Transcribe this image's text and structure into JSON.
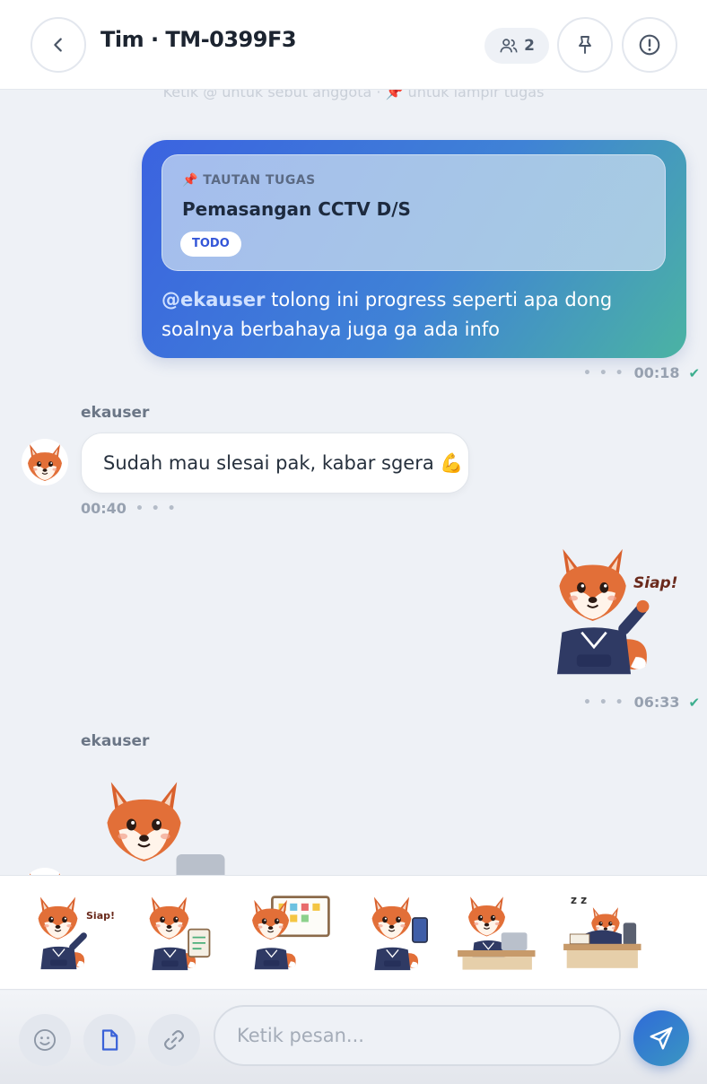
{
  "header": {
    "back_icon": "chevron-left-icon",
    "title": "Tim · TM-0399F3",
    "member_count": "2",
    "pin_icon": "pin-icon",
    "info_icon": "alert-circle-icon"
  },
  "hint": "Ketik @ untuk sebut anggota · 📌 untuk lampir tugas",
  "messages": [
    {
      "task_kicker": "📌 TAUTAN TUGAS",
      "task_title": "Pemasangan CCTV D/S",
      "task_status": "TODO",
      "mention": "@ekauser",
      "text": " tolong ini progress seperti apa dong soalnya berbahaya juga ga ada info",
      "time": "00:18"
    },
    {
      "sender": "ekauser",
      "text": "Sudah mau slesai pak, kabar sgera 💪",
      "time": "00:40"
    },
    {
      "sticker_caption": "Siap!",
      "time": "06:33"
    },
    {
      "sender": "ekauser"
    }
  ],
  "sticker_tray": [
    {
      "caption": "Siap!"
    },
    {
      "caption": ""
    },
    {
      "caption": ""
    },
    {
      "caption": ""
    },
    {
      "caption": ""
    },
    {
      "caption": "z z"
    }
  ],
  "composer": {
    "placeholder": "Ketik pesan...",
    "emoji_icon": "smile-icon",
    "file_icon": "document-icon",
    "link_icon": "link-icon",
    "send_icon": "send-icon"
  },
  "colors": {
    "accent": "#3b63e0",
    "teal": "#4bb3a3",
    "check": "#3cae8e",
    "fox": "#e0703a"
  }
}
